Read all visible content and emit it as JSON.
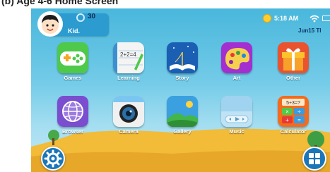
{
  "caption": "(b) Age 4-6 Home Screen",
  "profile": {
    "name": "Kid.",
    "coins": "30"
  },
  "status": {
    "time": "5:18 AM",
    "date": "Jun15 Tl"
  },
  "apps": [
    {
      "label": "Games",
      "icon": "gamepad-icon",
      "color": "#4ec94a"
    },
    {
      "label": "Learning",
      "icon": "notebook-icon",
      "color": "#f4f4f4"
    },
    {
      "label": "Story",
      "icon": "open-book-icon",
      "color": "#1a5fb4"
    },
    {
      "label": "Art",
      "icon": "palette-icon",
      "color": "#a32fd1"
    },
    {
      "label": "Other",
      "icon": "gift-icon",
      "color": "#e9542f"
    },
    {
      "label": "Browser",
      "icon": "globe-icon",
      "color": "#7a4ecf"
    },
    {
      "label": "Camera",
      "icon": "camera-icon",
      "color": "#f0f0f0"
    },
    {
      "label": "Gallery",
      "icon": "landscape-icon",
      "color": "#3aa0e0"
    },
    {
      "label": "Music",
      "icon": "music-player-icon",
      "color": "#bfe3f5"
    },
    {
      "label": "Calculator",
      "icon": "calculator-icon",
      "color": "#f36b1c"
    }
  ],
  "calculator_display": "5+3=?",
  "learning_text": "2+2=4",
  "dock": {
    "left": "settings-icon",
    "right": "app-grid-icon"
  }
}
